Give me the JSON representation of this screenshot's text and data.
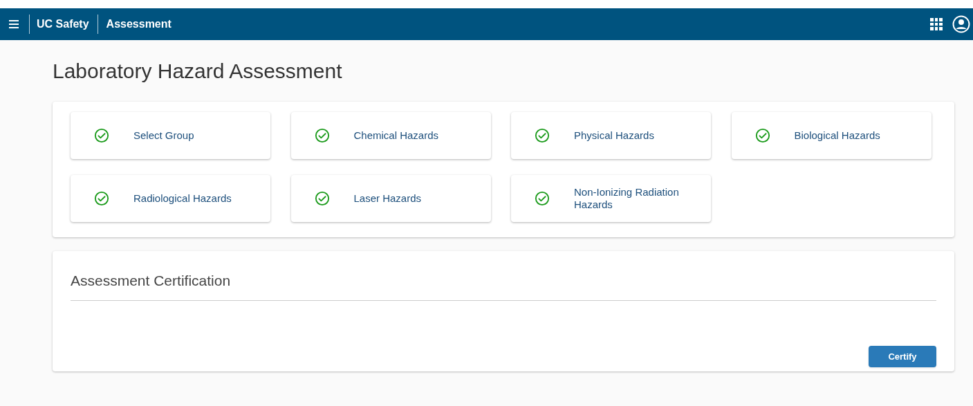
{
  "header": {
    "app_name": "UC Safety",
    "section": "Assessment"
  },
  "page_title": "Laboratory Hazard Assessment",
  "categories": [
    {
      "label": "Select Group",
      "completed": true
    },
    {
      "label": "Chemical Hazards",
      "completed": true
    },
    {
      "label": "Physical Hazards",
      "completed": true
    },
    {
      "label": "Biological Hazards",
      "completed": true
    },
    {
      "label": "Radiological Hazards",
      "completed": true
    },
    {
      "label": "Laser Hazards",
      "completed": true
    },
    {
      "label": "Non-Ionizing Radiation Hazards",
      "completed": true
    }
  ],
  "certification": {
    "title": "Assessment Certification",
    "button": "Certify"
  }
}
